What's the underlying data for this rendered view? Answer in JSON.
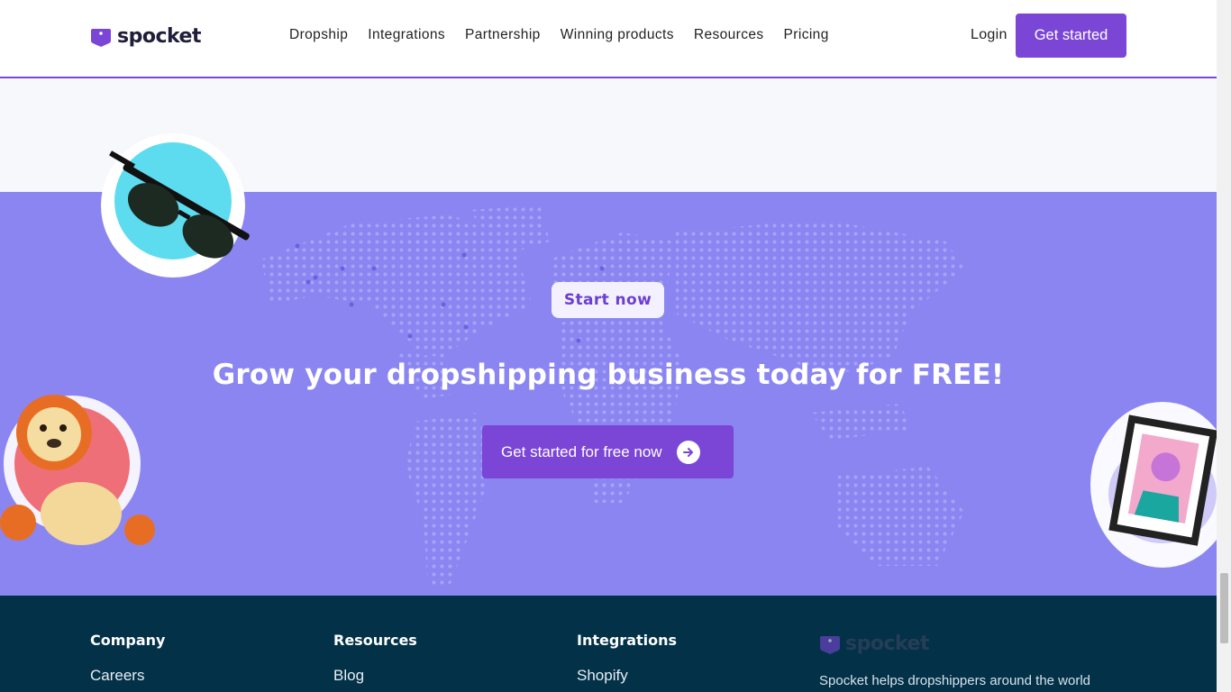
{
  "brand": {
    "name": "spocket",
    "color": "#7b45d6"
  },
  "nav": {
    "items": [
      "Dropship",
      "Integrations",
      "Partnership",
      "Winning products",
      "Resources",
      "Pricing"
    ],
    "login": "Login",
    "cta": "Get started"
  },
  "cta_section": {
    "badge": "Start now",
    "headline": "Grow your dropshipping business today for FREE!",
    "button": "Get started for free now",
    "background": "#8b85f2"
  },
  "footer": {
    "columns": [
      {
        "title": "Company",
        "links": [
          "Careers"
        ]
      },
      {
        "title": "Resources",
        "links": [
          "Blog"
        ]
      },
      {
        "title": "Integrations",
        "links": [
          "Shopify"
        ]
      }
    ],
    "logo": "spocket",
    "tagline": "Spocket helps dropshippers around the world"
  }
}
